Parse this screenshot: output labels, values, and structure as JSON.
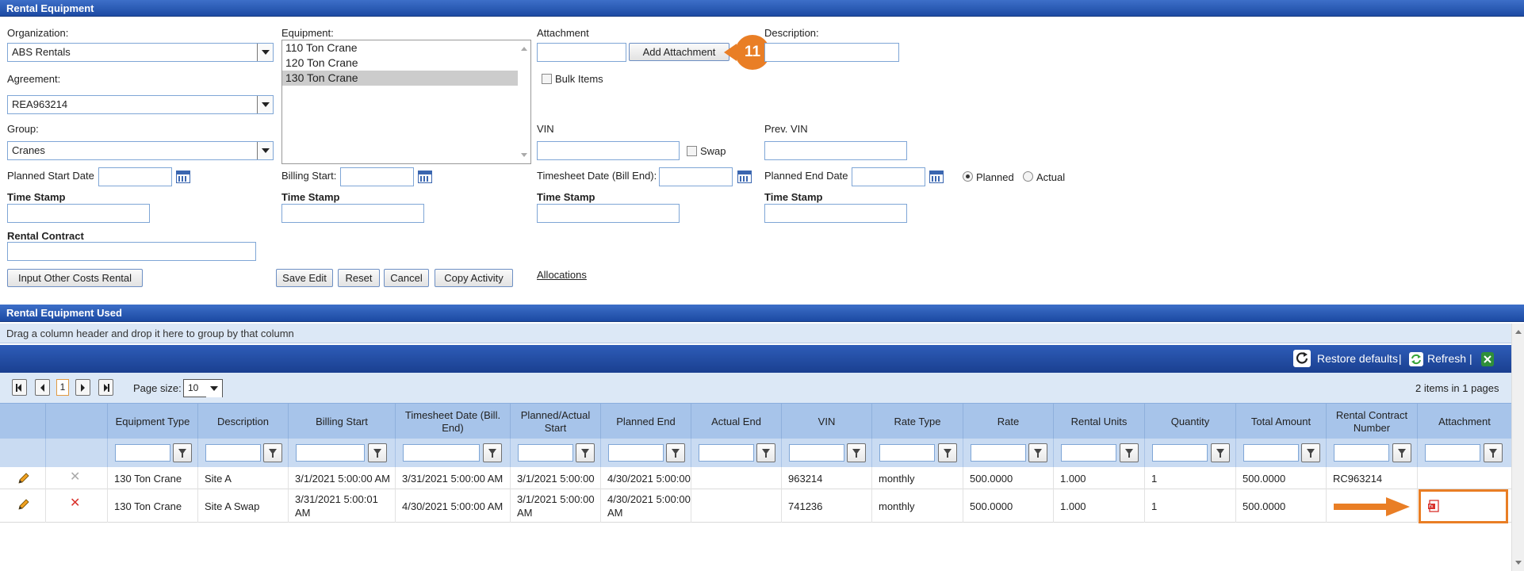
{
  "form_panel": {
    "title": "Rental Equipment",
    "organization": {
      "label": "Organization:",
      "value": "ABS Rentals"
    },
    "agreement": {
      "label": "Agreement:",
      "value": "REA963214"
    },
    "group": {
      "label": "Group:",
      "value": "Cranes"
    },
    "equipment": {
      "label": "Equipment:",
      "items": [
        "110 Ton Crane",
        "120 Ton Crane",
        "130 Ton Crane"
      ],
      "selected": "130 Ton Crane"
    },
    "attachment": {
      "label": "Attachment",
      "button": "Add Attachment"
    },
    "bulk_items": {
      "label": "Bulk Items"
    },
    "description": {
      "label": "Description:"
    },
    "vin": {
      "label": "VIN"
    },
    "swap": {
      "label": "Swap"
    },
    "prev_vin": {
      "label": "Prev. VIN"
    },
    "planned_start": {
      "label": "Planned Start Date"
    },
    "billing_start": {
      "label": "Billing Start:"
    },
    "timesheet_date": {
      "label": "Timesheet Date (Bill End):"
    },
    "planned_end": {
      "label": "Planned End Date"
    },
    "planned_radio": {
      "label": "Planned"
    },
    "actual_radio": {
      "label": "Actual"
    },
    "time_stamp_label": "Time Stamp",
    "rental_contract": {
      "label": "Rental Contract"
    },
    "buttons": {
      "input_other": "Input Other Costs Rental",
      "save_edit": "Save Edit",
      "reset": "Reset",
      "cancel": "Cancel",
      "copy_activity": "Copy Activity"
    },
    "allocations_link": "Allocations",
    "callout_number": "11"
  },
  "grid_panel": {
    "title": "Rental Equipment Used",
    "group_hint": "Drag a column header and drop it here to group by that column",
    "toolbar": {
      "restore": "Restore defaults",
      "refresh": "Refresh"
    },
    "pager": {
      "current_page": "1",
      "page_size_label": "Page size:",
      "page_size": "10",
      "summary": "2 items in 1 pages"
    },
    "columns": [
      "Equipment Type",
      "Description",
      "Billing Start",
      "Timesheet Date (Bill. End)",
      "Planned/Actual Start",
      "Planned End",
      "Actual End",
      "VIN",
      "Rate Type",
      "Rate",
      "Rental Units",
      "Quantity",
      "Total Amount",
      "Rental Contract Number",
      "Attachment"
    ],
    "rows": [
      {
        "equipment_type": "130 Ton Crane",
        "description": "Site A",
        "billing_start": "3/1/2021 5:00:00 AM",
        "timesheet_date": "3/31/2021 5:00:00 AM",
        "planned_actual_start": "3/1/2021 5:00:00",
        "planned_end": "4/30/2021 5:00:00",
        "actual_end": "",
        "vin": "963214",
        "rate_type": "monthly",
        "rate": "500.0000",
        "rental_units": "1.000",
        "quantity": "1",
        "total_amount": "500.0000",
        "rental_contract_number": "RC963214"
      },
      {
        "equipment_type": "130 Ton Crane",
        "description": "Site A Swap",
        "billing_start": "3/31/2021 5:00:01 AM",
        "timesheet_date": "4/30/2021 5:00:00 AM",
        "planned_actual_start": "3/1/2021 5:00:00 AM",
        "planned_end": "4/30/2021 5:00:00 AM",
        "actual_end": "",
        "vin": "741236",
        "rate_type": "monthly",
        "rate": "500.0000",
        "rental_units": "1.000",
        "quantity": "1",
        "total_amount": "500.0000",
        "rental_contract_number": ""
      }
    ]
  },
  "colors": {
    "header_blue": "#1c4aa3",
    "accent_orange": "#e97e25",
    "delete_red": "#d9322c"
  }
}
